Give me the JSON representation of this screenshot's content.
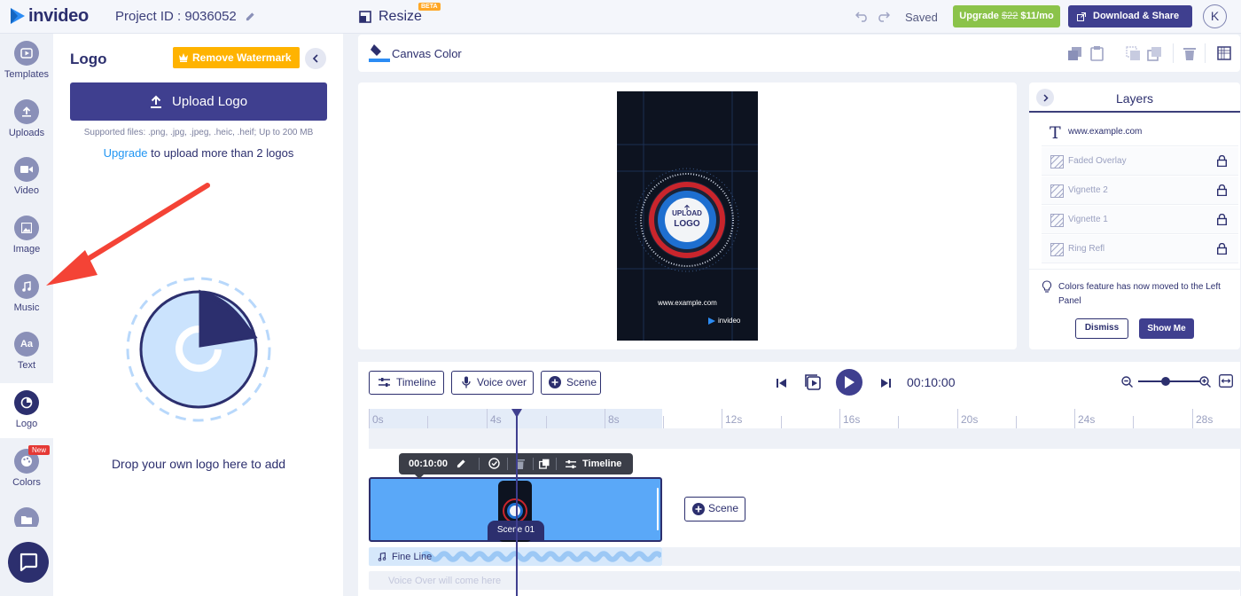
{
  "topbar": {
    "brand": "invideo",
    "project_id": "Project ID : 9036052",
    "resize_label": "Resize",
    "beta_badge": "BETA",
    "status": "Saved",
    "upgrade_price_old": "$22",
    "upgrade_label_pre": "Upgrade ",
    "upgrade_price_new": " $11/mo",
    "download_label": "Download & Share",
    "avatar_initial": "K"
  },
  "leftnav": {
    "items": [
      {
        "label": "Templates",
        "icon": "templates-icon"
      },
      {
        "label": "Uploads",
        "icon": "upload-icon"
      },
      {
        "label": "Video",
        "icon": "video-icon"
      },
      {
        "label": "Image",
        "icon": "image-icon"
      },
      {
        "label": "Music",
        "icon": "music-icon"
      },
      {
        "label": "Text",
        "icon": "text-icon",
        "glyph": "Aa"
      },
      {
        "label": "Logo",
        "icon": "logo-icon",
        "active": true
      },
      {
        "label": "Colors",
        "icon": "palette-icon",
        "badge": "New"
      }
    ]
  },
  "panel": {
    "title": "Logo",
    "watermark_button": "Remove Watermark",
    "upload_button": "Upload Logo",
    "supported": "Supported files: .png, .jpg, .jpeg, .heic, .heif; Up to 200 MB",
    "upgrade_link": "Upgrade",
    "upgrade_rest": " to upload more than 2 logos",
    "drop_text": "Drop your own logo here to add"
  },
  "canvas": {
    "label": "Canvas Color",
    "preview_upload": "UPLOAD",
    "preview_logo": "LOGO",
    "preview_url": "www.example.com",
    "preview_brand": "invideo"
  },
  "layers": {
    "title": "Layers",
    "items": [
      {
        "name": "www.example.com",
        "type": "text"
      },
      {
        "name": "Faded Overlay",
        "type": "image",
        "locked": true
      },
      {
        "name": "Vignette 2",
        "type": "image",
        "locked": true
      },
      {
        "name": "Vignette 1",
        "type": "image",
        "locked": true
      },
      {
        "name": "Ring Refl",
        "type": "image",
        "locked": true
      }
    ],
    "tip": "Colors feature has now moved to the Left Panel",
    "dismiss": "Dismiss",
    "show_me": "Show Me"
  },
  "timeline": {
    "timeline_button": "Timeline",
    "voice_button": "Voice over",
    "scene_button": "Scene",
    "time": "00:10:00",
    "ruler": [
      "0s",
      "4s",
      "8s",
      "12s",
      "16s",
      "20s",
      "24s",
      "28s"
    ],
    "clip_time": "00:10:00",
    "clip_timeline": "Timeline",
    "scene_label": "Scene 01",
    "add_scene": "Scene",
    "audio_label": "Fine Line",
    "voiceover_placeholder": "Voice Over will come here"
  },
  "colors": {
    "accent": "#3f3f8f",
    "upgrade_green": "#8bc34a",
    "watermark_yellow": "#ffb300",
    "arrow_red": "#f44336",
    "clip_blue": "#5aa8f8"
  }
}
